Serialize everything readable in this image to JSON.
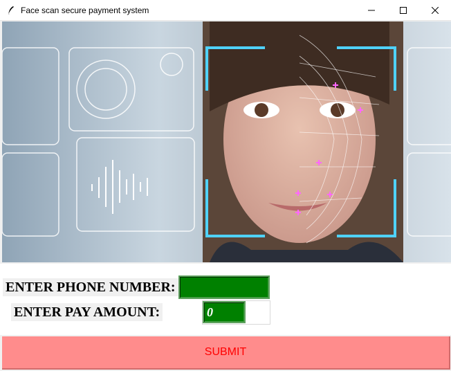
{
  "window": {
    "title": "Face scan secure payment system",
    "icon": "feather-icon",
    "controls": [
      "minimize-icon",
      "maximize-icon",
      "close-icon"
    ]
  },
  "banner": {
    "description_icon": "face-scan-image"
  },
  "form": {
    "phone_label": "ENTER PHONE NUMBER:",
    "phone_value": "",
    "amount_label": "ENTER PAY AMOUNT:",
    "amount_value": "0"
  },
  "submit": {
    "label": "SUBMIT"
  },
  "colors": {
    "entry_bg": "#008000",
    "submit_bg": "#ff8c8c",
    "submit_text": "#ff0000"
  }
}
